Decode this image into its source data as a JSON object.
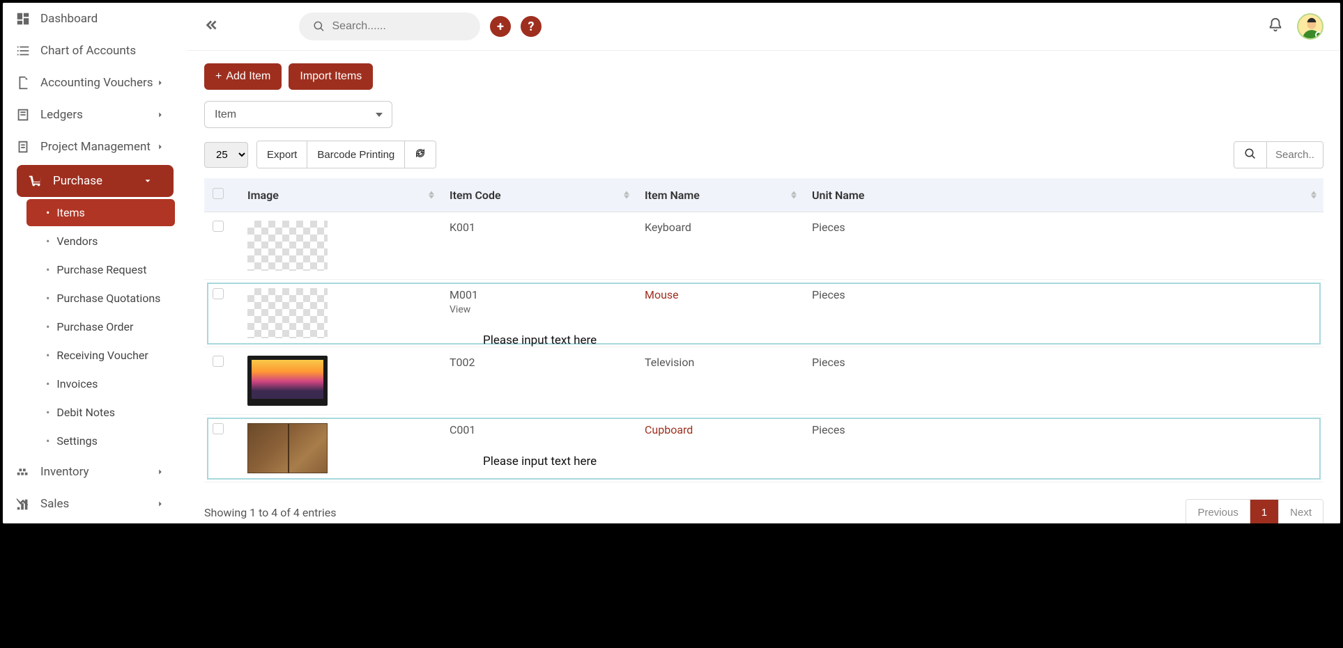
{
  "sidebar": {
    "items": [
      {
        "label": "Dashboard"
      },
      {
        "label": "Chart of Accounts"
      },
      {
        "label": "Accounting Vouchers"
      },
      {
        "label": "Ledgers"
      },
      {
        "label": "Project Management"
      },
      {
        "label": "Purchase"
      },
      {
        "label": "Inventory"
      },
      {
        "label": "Sales"
      }
    ],
    "purchase_sub": [
      {
        "label": "Items"
      },
      {
        "label": "Vendors"
      },
      {
        "label": "Purchase Request"
      },
      {
        "label": "Purchase Quotations"
      },
      {
        "label": "Purchase Order"
      },
      {
        "label": "Receiving Voucher"
      },
      {
        "label": "Invoices"
      },
      {
        "label": "Debit Notes"
      },
      {
        "label": "Settings"
      }
    ]
  },
  "topbar": {
    "search_placeholder": "Search......",
    "plus": "+",
    "help": "?"
  },
  "actions": {
    "add_item": "Add Item",
    "import_items": "Import Items"
  },
  "filter": {
    "label": "Item"
  },
  "toolbar": {
    "page_size": "25",
    "export": "Export",
    "barcode": "Barcode Printing",
    "refresh": "⟳",
    "search_placeholder": "Search.."
  },
  "table": {
    "headers": {
      "image": "Image",
      "item_code": "Item Code",
      "item_name": "Item Name",
      "unit_name": "Unit Name"
    },
    "rows": [
      {
        "code": "K001",
        "name": "Keyboard",
        "unit": "Pieces",
        "img": "checker",
        "highlight": false,
        "view": "",
        "overlay": ""
      },
      {
        "code": "M001",
        "name": "Mouse",
        "unit": "Pieces",
        "img": "checker",
        "highlight": true,
        "view": "View",
        "overlay": "Please input text here"
      },
      {
        "code": "T002",
        "name": "Television",
        "unit": "Pieces",
        "img": "tv",
        "highlight": false,
        "view": "",
        "overlay": ""
      },
      {
        "code": "C001",
        "name": "Cupboard",
        "unit": "Pieces",
        "img": "cupboard",
        "highlight": true,
        "view": "",
        "overlay": "Please input text here"
      }
    ]
  },
  "footer": {
    "showing": "Showing 1 to 4 of 4 entries",
    "prev": "Previous",
    "page": "1",
    "next": "Next"
  }
}
